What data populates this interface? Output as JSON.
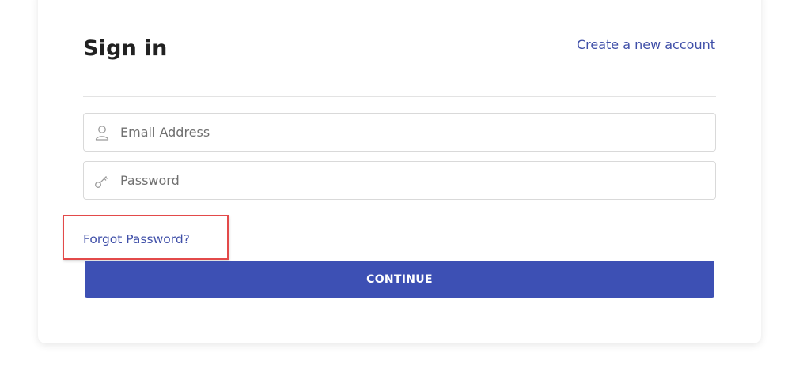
{
  "signin": {
    "title": "Sign in",
    "create_account_label": "Create a new account",
    "email": {
      "placeholder": "Email Address",
      "value": "",
      "icon": "user-icon"
    },
    "password": {
      "placeholder": "Password",
      "value": "",
      "icon": "key-icon"
    },
    "forgot_password_label": "Forgot Password?",
    "continue_label": "CONTINUE"
  },
  "colors": {
    "accent": "#3d50b4",
    "link": "#3f4fa8",
    "highlight": "#e34a4a",
    "title": "#212121"
  }
}
